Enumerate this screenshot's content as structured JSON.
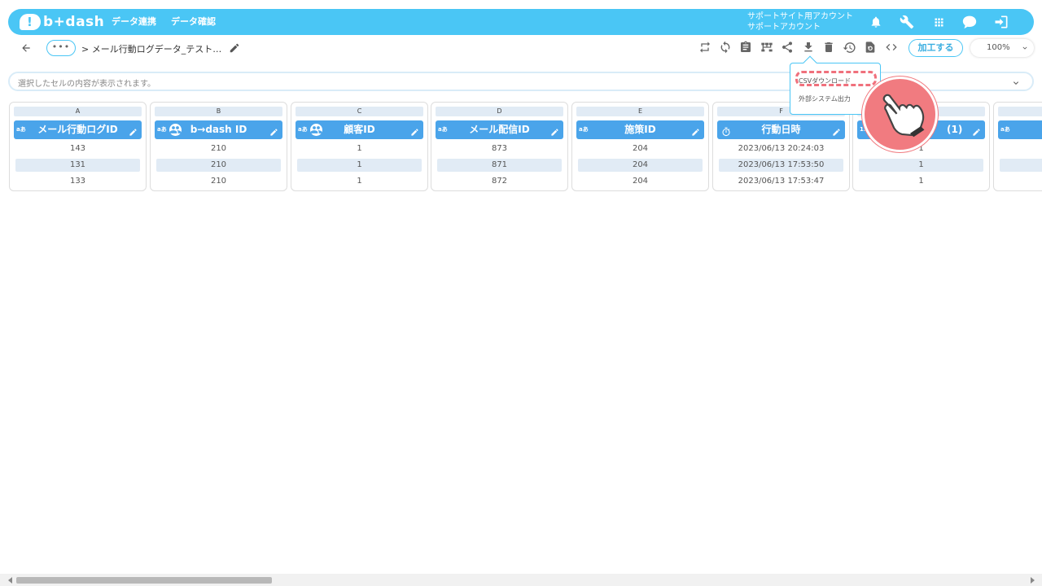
{
  "header": {
    "logo_text": "b+dash",
    "nav": [
      "データ連携",
      "データ確認"
    ],
    "account_line1": "サポートサイト用アカウント",
    "account_line2": "サポートアカウント"
  },
  "toolbar": {
    "more_label": "•••",
    "breadcrumb": "> メール行動ログデータ_テスト…",
    "process_button": "加工する",
    "zoom": "100%"
  },
  "cellbar": {
    "placeholder": "選択したセルの内容が表示されます。"
  },
  "columns": [
    {
      "letter": "A",
      "header": "メール行動ログID",
      "type": "aあ",
      "cells": [
        "143",
        "131",
        "133"
      ]
    },
    {
      "letter": "B",
      "header": "b→dash ID",
      "type": "aあ",
      "cells": [
        "210",
        "210",
        "210"
      ]
    },
    {
      "letter": "C",
      "header": "顧客ID",
      "type": "aあ",
      "cells": [
        "1",
        "1",
        "1"
      ]
    },
    {
      "letter": "D",
      "header": "メール配信ID",
      "type": "aあ",
      "cells": [
        "873",
        "871",
        "872"
      ]
    },
    {
      "letter": "E",
      "header": "施策ID",
      "type": "aあ",
      "cells": [
        "204",
        "204",
        "204"
      ]
    },
    {
      "letter": "F",
      "header": "行動日時",
      "type": "",
      "cells": [
        "2023/06/13 20:24:03",
        "2023/06/13 17:53:50",
        "2023/06/13 17:53:47"
      ]
    },
    {
      "letter": "",
      "header": "(1)",
      "type": "1.",
      "cells": [
        "1",
        "1",
        "1"
      ]
    },
    {
      "letter": "",
      "header": "",
      "type": "aあ",
      "cells": [
        "",
        "",
        ""
      ]
    }
  ],
  "popup": {
    "item1": "CSVダウンロード",
    "item2": "外部システム出力"
  },
  "colors": {
    "accent": "#4ac6f5",
    "header_blue": "#4aa4ea",
    "highlight": "#f0707c"
  }
}
